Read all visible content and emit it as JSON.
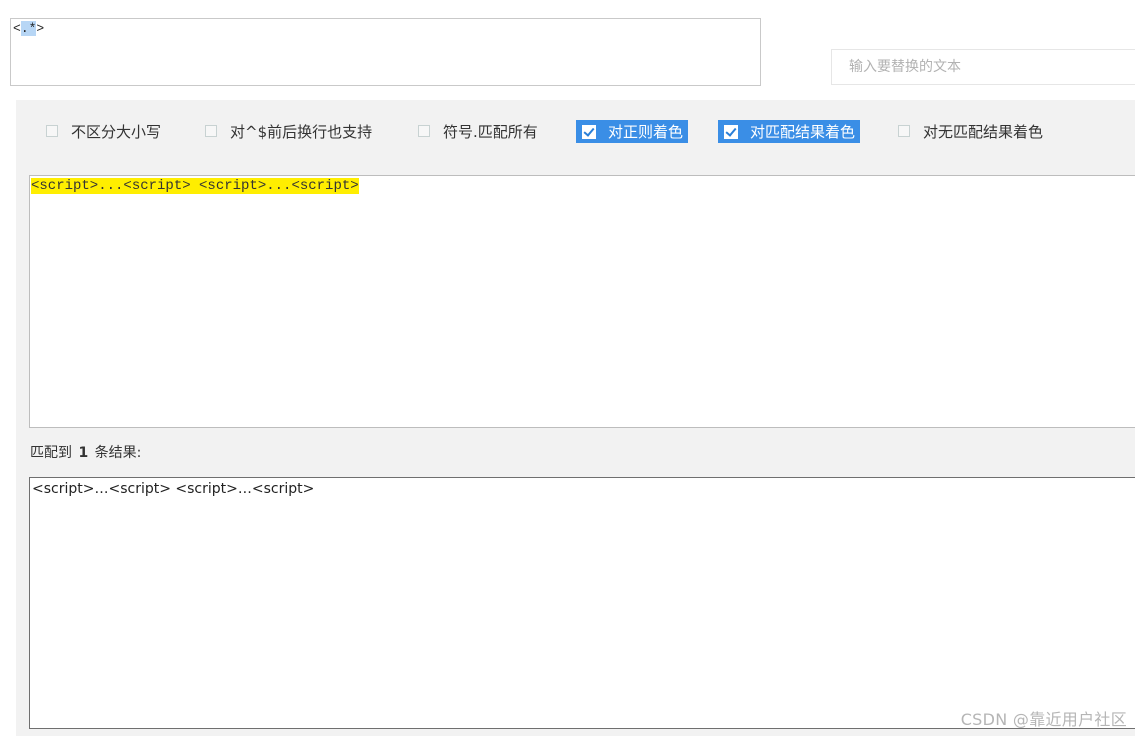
{
  "regex": {
    "prefix": "<",
    "selected": ".*",
    "suffix": ">"
  },
  "replace": {
    "placeholder": "输入要替换的文本"
  },
  "options": [
    {
      "label": "不区分大小写",
      "checked": false
    },
    {
      "label": "对^$前后换行也支持",
      "checked": false
    },
    {
      "label": "符号.匹配所有",
      "checked": false
    },
    {
      "label": "对正则着色",
      "checked": true
    },
    {
      "label": "对匹配结果着色",
      "checked": true
    },
    {
      "label": "对无匹配结果着色",
      "checked": false
    }
  ],
  "source_text": "<script>...<script> <script>...<script>",
  "result": {
    "prefix": "匹配到",
    "count": "1",
    "suffix": "条结果:",
    "text": "<script>…<script> <script>…<script>"
  },
  "watermark": "CSDN @靠近用户社区"
}
